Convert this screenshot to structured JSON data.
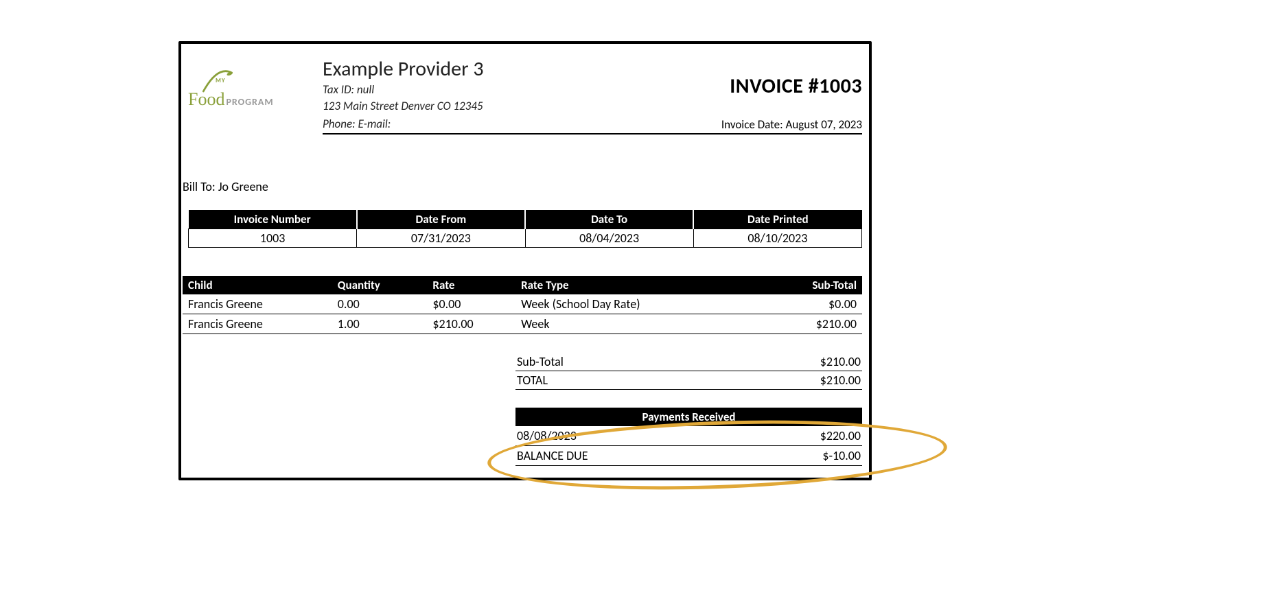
{
  "logo": {
    "my": "MY",
    "food": "Food",
    "program": "PROGRAM"
  },
  "header": {
    "provider_name": "Example Provider 3",
    "tax_id_label": "Tax ID: null",
    "address": "123 Main Street Denver CO 12345",
    "contact_label": "Phone: E-mail:",
    "invoice_number_display": "INVOICE #1003",
    "invoice_date_display": "Invoice Date: August 07, 2023"
  },
  "bill_to": {
    "label": "Bill To:",
    "name": "Jo Greene"
  },
  "meta": {
    "headers": {
      "invoice_number": "Invoice Number",
      "date_from": "Date From",
      "date_to": "Date To",
      "date_printed": "Date Printed"
    },
    "row": {
      "invoice_number": "1003",
      "date_from": "07/31/2023",
      "date_to": "08/04/2023",
      "date_printed": "08/10/2023"
    }
  },
  "lines": {
    "headers": {
      "child": "Child",
      "quantity": "Quantity",
      "rate": "Rate",
      "rate_type": "Rate Type",
      "subtotal": "Sub-Total"
    },
    "rows": [
      {
        "child": "Francis Greene",
        "quantity": "0.00",
        "rate": "$0.00",
        "rate_type": "Week (School Day Rate)",
        "subtotal": "$0.00"
      },
      {
        "child": "Francis Greene",
        "quantity": "1.00",
        "rate": "$210.00",
        "rate_type": "Week",
        "subtotal": "$210.00"
      }
    ]
  },
  "totals": {
    "subtotal_label": "Sub-Total",
    "subtotal": "$210.00",
    "total_label": "TOTAL",
    "total": "$210.00"
  },
  "payments": {
    "header": "Payments Received",
    "rows": [
      {
        "date": "08/08/2023",
        "amount": "$220.00"
      }
    ],
    "balance_label": "BALANCE DUE",
    "balance": "$-10.00"
  }
}
